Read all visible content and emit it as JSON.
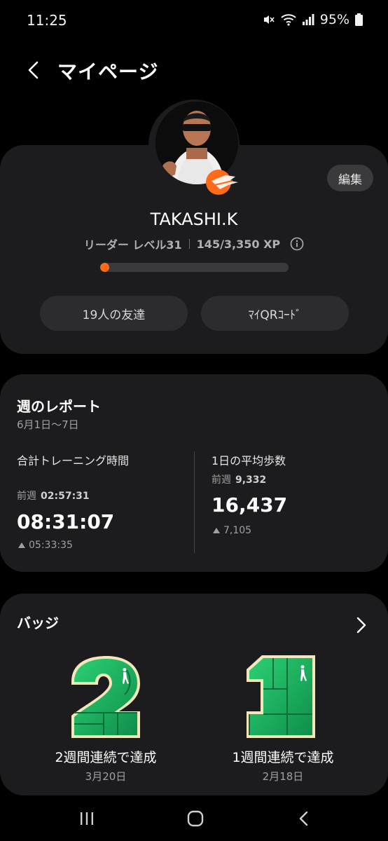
{
  "status_bar": {
    "time": "11:25",
    "battery": "95%"
  },
  "header": {
    "title": "マイページ"
  },
  "profile": {
    "edit_label": "編集",
    "username": "TAKASHI.K",
    "level_label": "リーダー レベル31",
    "xp_text": "145/3,350 XP",
    "xp_progress": 0.043,
    "friends_label": "19人の友達",
    "qr_label": "ﾏｲQRｺｰﾄﾞ"
  },
  "weekly_report": {
    "title": "週のレポート",
    "range": "6月1日〜7日",
    "training": {
      "label": "合計トレーニング時間",
      "prev_label": "前週",
      "prev_value": "02:57:31",
      "value": "08:31:07",
      "delta": "05:33:35"
    },
    "steps": {
      "label": "1日の平均歩数",
      "prev_label": "前週",
      "prev_value": "9,332",
      "value": "16,437",
      "delta": "7,105"
    }
  },
  "badges": {
    "title": "バッジ",
    "items": [
      {
        "number": "2",
        "caption": "2週間連続で達成",
        "date": "3月20日"
      },
      {
        "number": "1",
        "caption": "1週間連続で達成",
        "date": "2月18日"
      }
    ]
  },
  "colors": {
    "accent": "#ff6a1a",
    "badge_green": "#1fa85c",
    "card_bg": "#1c1c1e"
  },
  "icons": [
    "back-icon",
    "wifi-icon",
    "signal-icon",
    "mute-icon",
    "battery-icon",
    "info-icon",
    "chevron-right-icon",
    "walker-icon",
    "recents-icon",
    "home-icon",
    "nav-back-icon"
  ]
}
